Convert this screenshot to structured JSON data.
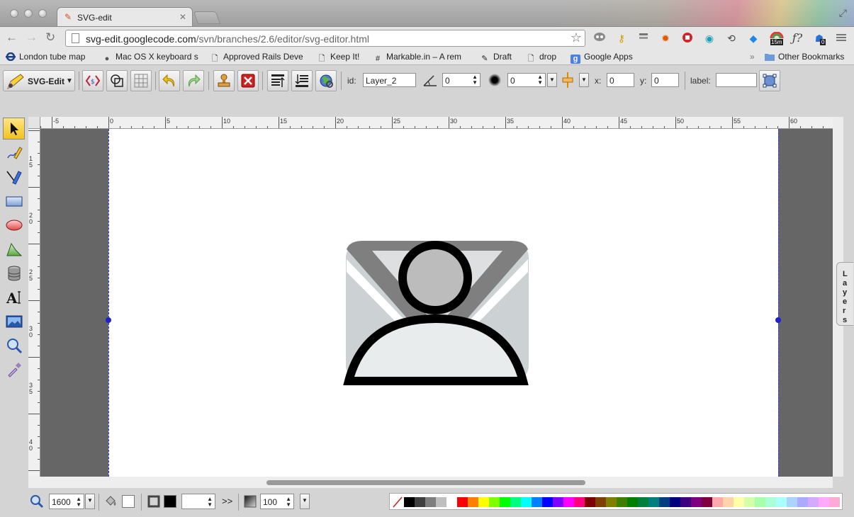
{
  "browser": {
    "tab_title": "SVG-edit",
    "url_host": "svg-edit.googlecode.com",
    "url_path": "/svn/branches/2.6/editor/svg-editor.html",
    "ext_badge_time": "15m",
    "ext_badge_count": "0",
    "bookmarks": [
      {
        "label": "London tube map",
        "icon": "tube-icon"
      },
      {
        "label": "Mac OS X keyboard s",
        "icon": "apple-icon"
      },
      {
        "label": "Approved Rails Deve",
        "icon": "page-icon"
      },
      {
        "label": "Keep It!",
        "icon": "page-icon"
      },
      {
        "label": "Markable.in – A rem",
        "icon": "hash-icon"
      },
      {
        "label": "Draft",
        "icon": "pencil-icon"
      },
      {
        "label": "drop",
        "icon": "page-icon"
      },
      {
        "label": "Google Apps",
        "icon": "google-icon"
      }
    ],
    "overflow_chevron": "»",
    "other_bookmarks": "Other Bookmarks"
  },
  "toolbar": {
    "app_menu_label": "SVG-Edit",
    "id_label": "id:",
    "id_value": "Layer_2",
    "angle_value": "0",
    "blur_value": "0",
    "x_label": "x:",
    "x_value": "0",
    "y_label": "y:",
    "y_value": "0",
    "label_label": "label:",
    "label_value": ""
  },
  "ruler_x_labels": [
    "-5",
    "0",
    "5",
    "10",
    "15",
    "20",
    "25",
    "30",
    "35",
    "40",
    "45",
    "50",
    "55",
    "60"
  ],
  "ruler_y_labels": [
    "1 5",
    "2 0",
    "2 5",
    "3 0",
    "3 5",
    "4 0"
  ],
  "layers_label": "Layers",
  "bottom": {
    "zoom_value": "1600",
    "stroke_width_value": "",
    "opacity_value": "100",
    "more_label": ">>"
  },
  "palette_colors": [
    "#000000",
    "#3f3f3f",
    "#7f7f7f",
    "#bfbfbf",
    "#ffffff",
    "#ff0000",
    "#ff7f00",
    "#ffff00",
    "#7fff00",
    "#00ff00",
    "#00ff7f",
    "#00ffff",
    "#007fff",
    "#0000ff",
    "#7f00ff",
    "#ff00ff",
    "#ff007f",
    "#7f0000",
    "#7f3f00",
    "#7f7f00",
    "#3f7f00",
    "#007f00",
    "#007f3f",
    "#007f7f",
    "#003f7f",
    "#00007f",
    "#3f007f",
    "#7f007f",
    "#7f003f",
    "#ffaaaa",
    "#ffd4aa",
    "#ffffaa",
    "#d4ffaa",
    "#aaffaa",
    "#aaffd4",
    "#aaffff",
    "#aad4ff",
    "#aaaaff",
    "#d4aaff",
    "#ffaaff",
    "#ffaad4"
  ],
  "colors": {
    "fill": "#000000",
    "stroke": "#ffffff",
    "selected_tool": "#f1c31d",
    "guide": "#3a3adb"
  }
}
